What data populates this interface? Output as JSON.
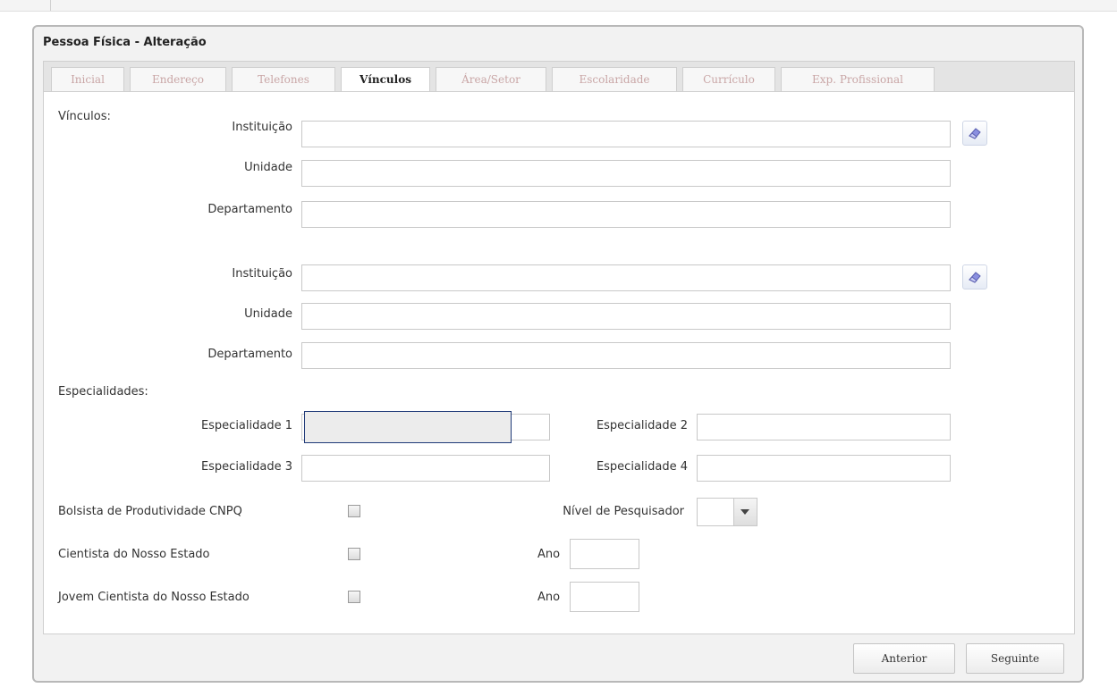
{
  "window": {
    "title": "Pessoa Física - Alteração"
  },
  "tabs": [
    {
      "label": "Inicial",
      "active": false
    },
    {
      "label": "Endereço",
      "active": false
    },
    {
      "label": "Telefones",
      "active": false
    },
    {
      "label": "Vínculos",
      "active": true
    },
    {
      "label": "Área/Setor",
      "active": false
    },
    {
      "label": "Escolaridade",
      "active": false
    },
    {
      "label": "Currículo",
      "active": false
    },
    {
      "label": "Exp. Profissional",
      "active": false
    }
  ],
  "vinculos": {
    "section_label": "Vínculos:",
    "groups": [
      {
        "instituicao_label": "Instituição",
        "instituicao_value": "",
        "unidade_label": "Unidade",
        "unidade_value": "",
        "departamento_label": "Departamento",
        "departamento_value": ""
      },
      {
        "instituicao_label": "Instituição",
        "instituicao_value": "",
        "unidade_label": "Unidade",
        "unidade_value": "",
        "departamento_label": "Departamento",
        "departamento_value": ""
      }
    ]
  },
  "especialidades": {
    "section_label": "Especialidades:",
    "fields": [
      {
        "label": "Especialidade 1",
        "value": ""
      },
      {
        "label": "Especialidade 2",
        "value": ""
      },
      {
        "label": "Especialidade 3",
        "value": ""
      },
      {
        "label": "Especialidade 4",
        "value": ""
      }
    ]
  },
  "flags": [
    {
      "label": "Bolsista de Produtividade CNPQ",
      "checked": false
    },
    {
      "label": "Cientista do Nosso Estado",
      "checked": false
    },
    {
      "label": "Jovem Cientista do Nosso Estado",
      "checked": false
    }
  ],
  "pesquisador": {
    "nivel_label": "Nível de Pesquisador",
    "nivel_value": "",
    "ano1_label": "Ano",
    "ano1_value": "",
    "ano2_label": "Ano",
    "ano2_value": ""
  },
  "footer": {
    "anterior_label": "Anterior",
    "seguinte_label": "Seguinte"
  },
  "icons": {
    "clear": "eraser-icon",
    "dropdown": "chevron-down-icon"
  },
  "colors": {
    "tab_inactive_text": "#c9a6a6",
    "focus_border": "#1f3a78",
    "eraser_body": "#8a8fe0"
  }
}
